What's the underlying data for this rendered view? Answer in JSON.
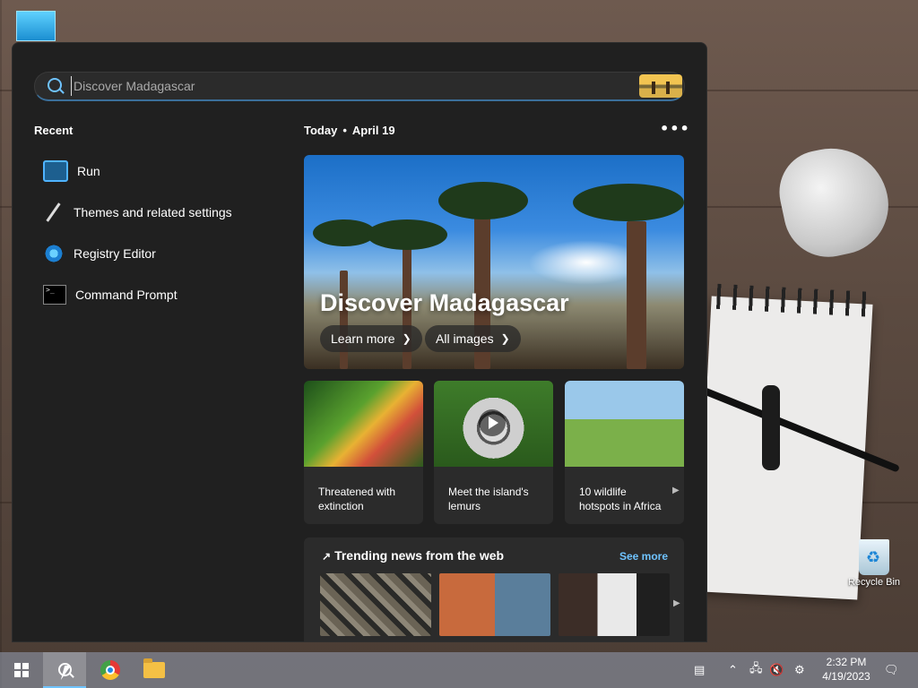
{
  "search": {
    "placeholder": "Discover Madagascar"
  },
  "recent": {
    "title": "Recent",
    "items": [
      {
        "label": "Run",
        "icon": "run-icon"
      },
      {
        "label": "Themes and related settings",
        "icon": "brush-icon"
      },
      {
        "label": "Registry Editor",
        "icon": "registry-editor-icon"
      },
      {
        "label": "Command Prompt",
        "icon": "command-prompt-icon"
      }
    ]
  },
  "today": {
    "label": "Today",
    "date": "April 19",
    "more": "•••"
  },
  "hero": {
    "title": "Discover Madagascar",
    "learn_more": "Learn more",
    "all_images": "All images"
  },
  "cards": [
    {
      "caption": "Threatened with extinction"
    },
    {
      "caption": "Meet the island's lemurs"
    },
    {
      "caption": "10 wildlife hotspots in Africa"
    }
  ],
  "trending": {
    "title": "Trending news from the web",
    "see_more": "See more"
  },
  "desktop": {
    "recycle_bin": "Recycle Bin"
  },
  "taskbar": {
    "time": "2:32 PM",
    "date": "4/19/2023"
  },
  "colors": {
    "accent": "#6fc3ff",
    "panel_bg": "#202020",
    "card_bg": "#2b2b2b"
  }
}
